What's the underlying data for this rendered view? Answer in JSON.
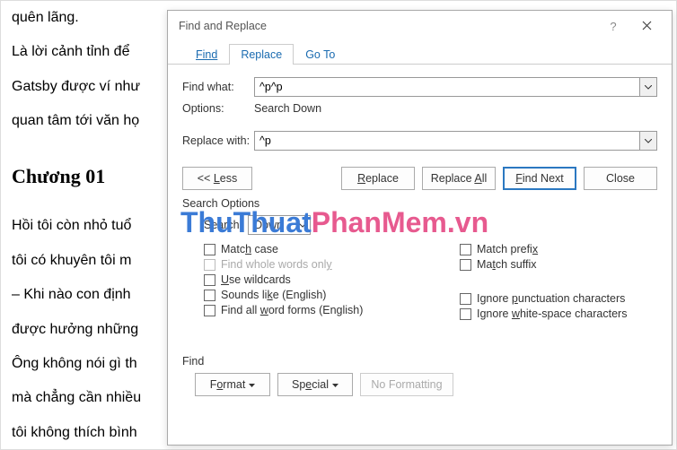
{
  "document": {
    "p1": "quên lãng.",
    "p2": "Là lời cảnh tỉnh để",
    "p3": "Gatsby được ví như",
    "p4": "quan tâm tới văn họ",
    "h": "Chương 01",
    "p5": "Hồi tôi còn nhỏ tuổ",
    "p6": "tôi có khuyên tôi m",
    "p7": "– Khi nào con định",
    "p8": "được hưởng những",
    "p9": "Ông không nói gì th",
    "p10": "mà chẳng cần nhiều",
    "p11": "tôi không thích bình"
  },
  "dialog": {
    "title": "Find and Replace",
    "help": "?",
    "tabs": {
      "find": "Find",
      "replace": "Replace",
      "goto": "Go To"
    },
    "find_what_label": "Find what:",
    "find_what_value": "^p^p",
    "options_label": "Options:",
    "options_value": "Search Down",
    "replace_with_label": "Replace with:",
    "replace_with_value": "^p",
    "buttons": {
      "less": "<< Less",
      "replace": "Replace",
      "replace_all": "Replace All",
      "find_next": "Find Next",
      "close": "Close"
    },
    "section_search_options": "Search Options",
    "search_label": "Search:",
    "search_value": "Down",
    "checks": {
      "match_case": "Match case",
      "whole_words": "Find whole words only",
      "wildcards": "Use wildcards",
      "sounds_like": "Sounds like (English)",
      "word_forms": "Find all word forms (English)",
      "match_prefix": "Match prefix",
      "match_suffix": "Match suffix",
      "ignore_punct": "Ignore punctuation characters",
      "ignore_white": "Ignore white-space characters"
    },
    "find_group": "Find",
    "format": "Format",
    "special": "Special",
    "no_formatting": "No Formatting"
  },
  "watermark": {
    "tt": "ThuThuat",
    "pm": "PhanMem",
    "vn": ".vn"
  }
}
